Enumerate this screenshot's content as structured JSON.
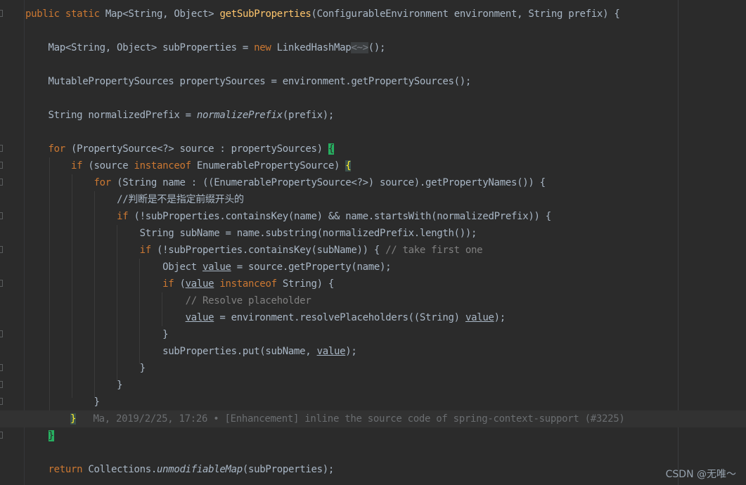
{
  "code": {
    "top_fragment": "*/",
    "line_signature": {
      "mod1": "public",
      "mod2": "static",
      "ret": "Map<String, Object>",
      "name": "getSubProperties",
      "params": "(ConfigurableEnvironment environment, String prefix) {"
    },
    "line_map_decl": {
      "lhs": "Map<String, Object> subProperties = ",
      "kw_new": "new",
      "cls": " LinkedHashMap",
      "diamond": "<~>",
      "end": "();"
    },
    "line_sources": "MutablePropertySources propertySources = environment.getPropertySources();",
    "line_prefix": {
      "lhs": "String normalizedPrefix = ",
      "call": "normalizePrefix",
      "args": "(prefix);"
    },
    "line_for1": {
      "kw": "for",
      "body": " (PropertySource<?> source : propertySources) ",
      "brace": "{"
    },
    "line_if1": {
      "kw": "if",
      "body1": " (source ",
      "kw2": "instanceof",
      "body2": " EnumerablePropertySource) ",
      "brace": "{"
    },
    "line_for2": {
      "kw": "for",
      "body": " (String name : ((EnumerablePropertySource<?>) source).getPropertyNames()) {"
    },
    "line_comment1": "//判断是不是指定前缀开头的",
    "line_if2": {
      "kw": "if",
      "body": " (!subProperties.containsKey(name) && name.startsWith(normalizedPrefix)) {"
    },
    "line_subname": "String subName = name.substring(normalizedPrefix.length());",
    "line_if3": {
      "kw": "if",
      "body": " (!subProperties.containsKey(subName)) { ",
      "comment": "// take first one"
    },
    "line_obj": {
      "pre": "Object ",
      "var": "value",
      "post": " = source.getProperty(name);"
    },
    "line_if4": {
      "kw": "if",
      "pre": " (",
      "var": "value",
      "kw2": " instanceof",
      "post": " String) {"
    },
    "line_comment2": "// Resolve placeholder",
    "line_resolve": {
      "var": "value",
      "mid": " = environment.resolvePlaceholders((String) ",
      "var2": "value",
      "end": ");"
    },
    "close_brace": "}",
    "line_put": {
      "pre": "subProperties.put(subName, ",
      "var": "value",
      "end": ");"
    },
    "line_blame": "Ma, 2019/2/25, 17:26 • [Enhancement] inline the source code of spring-context-support (#3225)",
    "line_return": {
      "kw": "return",
      "pre": " Collections.",
      "call": "unmodifiableMap",
      "end": "(subProperties);"
    }
  },
  "watermark": "CSDN @无唯～",
  "colors": {
    "background": "#2b2b2b",
    "keyword": "#cc7832",
    "function": "#ffc66d",
    "text": "#a9b7c6",
    "comment": "#808080",
    "brace_match": "#27ae60"
  }
}
